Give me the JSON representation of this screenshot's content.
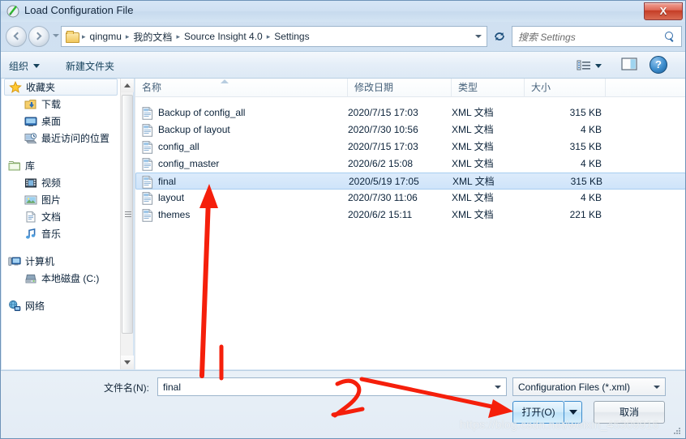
{
  "window": {
    "title": "Load Configuration File",
    "title_icon": "app-pen-icon",
    "close_label": "X"
  },
  "navbar": {
    "back_icon": "back-arrow-icon",
    "forward_icon": "forward-arrow-icon",
    "history_icon": "history-dropdown-icon",
    "breadcrumbs": [
      "qingmu",
      "我的文档",
      "Source Insight 4.0",
      "Settings"
    ],
    "separator": "▸",
    "refresh_icon": "refresh-icon",
    "search_placeholder": "搜索 Settings",
    "search_icon": "search-icon"
  },
  "commandbar": {
    "organize_label": "组织",
    "new_folder_label": "新建文件夹",
    "views_icon": "view-list-icon",
    "preview_icon": "preview-pane-icon",
    "help_icon": "help-icon",
    "help_label": "?"
  },
  "sidebar": {
    "groups": [
      {
        "header": {
          "label": "收藏夹",
          "icon": "star-icon",
          "selected": true
        },
        "items": [
          {
            "label": "下载",
            "icon": "downloads-icon"
          },
          {
            "label": "桌面",
            "icon": "desktop-icon"
          },
          {
            "label": "最近访问的位置",
            "icon": "recent-places-icon"
          }
        ]
      },
      {
        "header": {
          "label": "库",
          "icon": "library-icon",
          "selected": false
        },
        "items": [
          {
            "label": "视频",
            "icon": "videos-icon"
          },
          {
            "label": "图片",
            "icon": "pictures-icon"
          },
          {
            "label": "文档",
            "icon": "documents-icon"
          },
          {
            "label": "音乐",
            "icon": "music-icon"
          }
        ]
      },
      {
        "header": {
          "label": "计算机",
          "icon": "computer-icon",
          "selected": false
        },
        "items": [
          {
            "label": "本地磁盘 (C:)",
            "icon": "local-disk-icon"
          }
        ]
      },
      {
        "header": {
          "label": "网络",
          "icon": "network-icon",
          "selected": false
        },
        "items": []
      }
    ],
    "scrollbar": {
      "up_icon": "scroll-up-icon",
      "down_icon": "scroll-down-icon"
    }
  },
  "filelist": {
    "columns": [
      "名称",
      "修改日期",
      "类型",
      "大小"
    ],
    "sort_indicator": "ascending",
    "rows": [
      {
        "name": "Backup of config_all",
        "date": "2020/7/15 17:03",
        "type": "XML 文档",
        "size": "315 KB",
        "selected": false
      },
      {
        "name": "Backup of layout",
        "date": "2020/7/30 10:56",
        "type": "XML 文档",
        "size": "4 KB",
        "selected": false
      },
      {
        "name": "config_all",
        "date": "2020/7/15 17:03",
        "type": "XML 文档",
        "size": "315 KB",
        "selected": false
      },
      {
        "name": "config_master",
        "date": "2020/6/2 15:08",
        "type": "XML 文档",
        "size": "4 KB",
        "selected": false
      },
      {
        "name": "final",
        "date": "2020/5/19 17:05",
        "type": "XML 文档",
        "size": "315 KB",
        "selected": true
      },
      {
        "name": "layout",
        "date": "2020/7/30 11:06",
        "type": "XML 文档",
        "size": "4 KB",
        "selected": false
      },
      {
        "name": "themes",
        "date": "2020/6/2 15:11",
        "type": "XML 文档",
        "size": "221 KB",
        "selected": false
      }
    ],
    "file_icon": "xml-document-icon"
  },
  "footer": {
    "filename_label": "文件名(N):",
    "filename_value": "final",
    "filter_value": "Configuration Files (*.xml)",
    "open_label": "打开(O)",
    "cancel_label": "取消",
    "resize_grip_icon": "resize-grip-icon"
  },
  "annotations": {
    "marker_1": "1",
    "marker_2": "2",
    "arrow_color": "#f51f0b",
    "arrow_up_target": "final-row",
    "arrow_diagonal_target": "open-button"
  },
  "watermark": "https://blog.csdn.net/weixin_45309916"
}
